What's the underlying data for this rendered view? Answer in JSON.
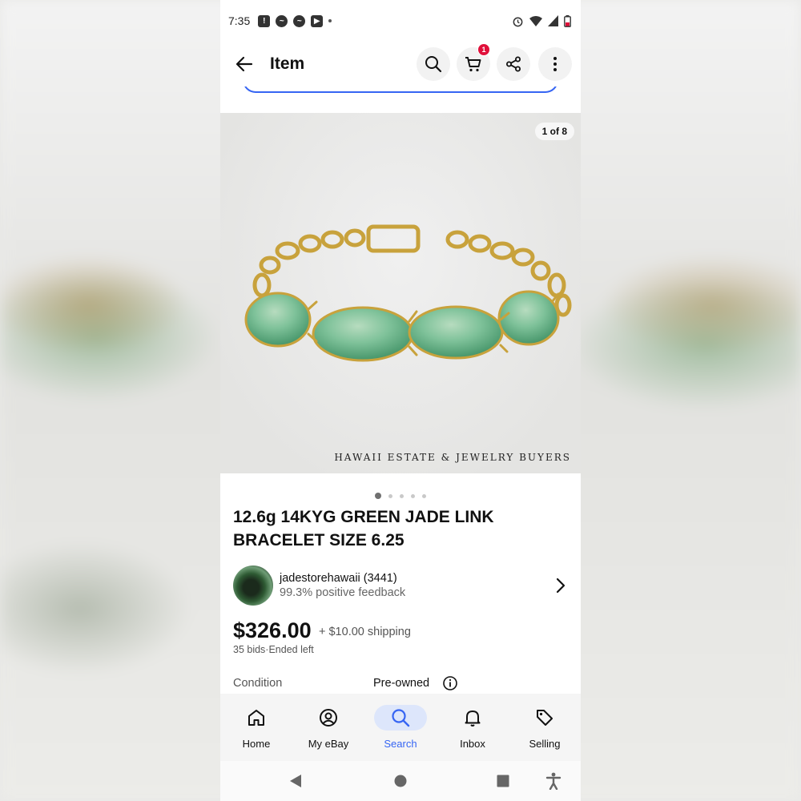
{
  "status_bar": {
    "time": "7:35",
    "left_icons": [
      "alert-icon",
      "messenger-icon",
      "messenger-icon",
      "youtube-icon",
      "dot-icon"
    ],
    "right_icons": [
      "alarm-icon",
      "wifi-icon",
      "signal-icon",
      "battery-icon"
    ]
  },
  "header": {
    "title": "Item",
    "cart_count": "1",
    "icons": [
      "back-arrow-icon",
      "search-icon",
      "cart-icon",
      "share-icon",
      "more-vert-icon"
    ]
  },
  "gallery": {
    "counter": "1 of 8",
    "watermark": "HAWAII ESTATE & JEWELRY BUYERS",
    "dot_count": 5,
    "active_dot": 1
  },
  "item": {
    "title": "12.6g 14KYG GREEN JADE LINK BRACELET SIZE 6.25",
    "seller_name": "jadestorehawaii (3441)",
    "seller_feedback": "99.3% positive feedback",
    "price": "$326.00",
    "shipping": "+ $10.00 shipping",
    "bids": "35 bids·Ended left",
    "condition_label": "Condition",
    "condition_value": "Pre-owned"
  },
  "bottom_nav": {
    "items": [
      {
        "label": "Home",
        "icon": "home-icon"
      },
      {
        "label": "My eBay",
        "icon": "account-icon"
      },
      {
        "label": "Search",
        "icon": "search-icon"
      },
      {
        "label": "Inbox",
        "icon": "bell-icon"
      },
      {
        "label": "Selling",
        "icon": "tag-icon"
      }
    ],
    "active": "Search"
  },
  "colors": {
    "accent": "#3665f3",
    "badge": "#e0103a",
    "active_pill": "#dde6fb",
    "jade": "#7fc29a",
    "gold": "#c8a23c"
  }
}
